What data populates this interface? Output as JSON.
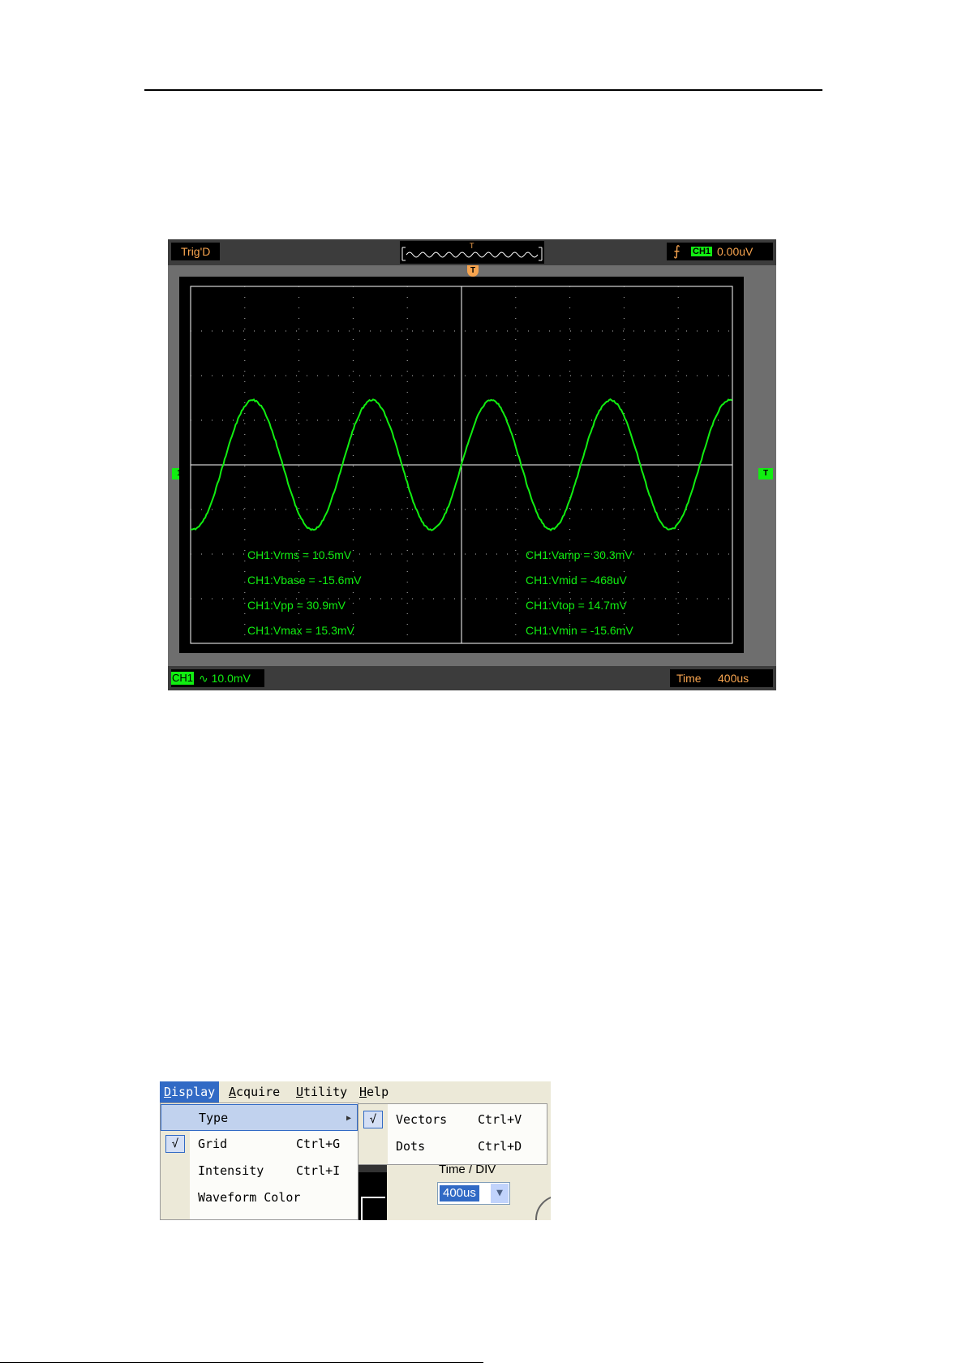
{
  "scope": {
    "trigger_status": "Trig'D",
    "preview_trigger_mark": "T",
    "trigger_edge_icon": "rising-edge-icon",
    "trigger_channel": "CH1",
    "trigger_level": "0.00uV",
    "channel_marker": "1",
    "trigger_level_marker": "T",
    "trigger_position_marker": "T",
    "measurements_left": [
      "CH1:Vrms = 10.5mV",
      "CH1:Vbase = -15.6mV",
      "CH1:Vpp = 30.9mV",
      "CH1:Vmax = 15.3mV"
    ],
    "measurements_right": [
      "CH1:Vamp = 30.3mV",
      "CH1:Vmid = -468uV",
      "CH1:Vtop = 14.7mV",
      "CH1:Vmin = -15.6mV"
    ],
    "channel_tag": "CH1",
    "channel_scale": "∿ 10.0mV",
    "time_label": "Time",
    "time_value": "400us",
    "colors": {
      "trace": "#11ee11",
      "trigger": "#f7a44f",
      "screen": "#000000"
    }
  },
  "menu": {
    "bar": [
      {
        "label": "Display",
        "mnemonic": "D"
      },
      {
        "label": "Acquire",
        "mnemonic": "A"
      },
      {
        "label": "Utility",
        "mnemonic": "U"
      },
      {
        "label": "Help",
        "mnemonic": "H"
      }
    ],
    "display_items": [
      {
        "label": "Type",
        "shortcut": "",
        "checked": false,
        "submenu": true
      },
      {
        "label": "Grid",
        "shortcut": "Ctrl+G",
        "checked": true
      },
      {
        "label": "Intensity",
        "shortcut": "Ctrl+I",
        "checked": false
      },
      {
        "label": "Waveform Color",
        "shortcut": "",
        "checked": false
      }
    ],
    "type_submenu": [
      {
        "label": "Vectors",
        "shortcut": "Ctrl+V",
        "checked": true
      },
      {
        "label": "Dots",
        "shortcut": "Ctrl+D",
        "checked": false
      }
    ],
    "check_glyph": "√",
    "time_div_label": "Time / DIV",
    "time_div_value": "400us"
  }
}
